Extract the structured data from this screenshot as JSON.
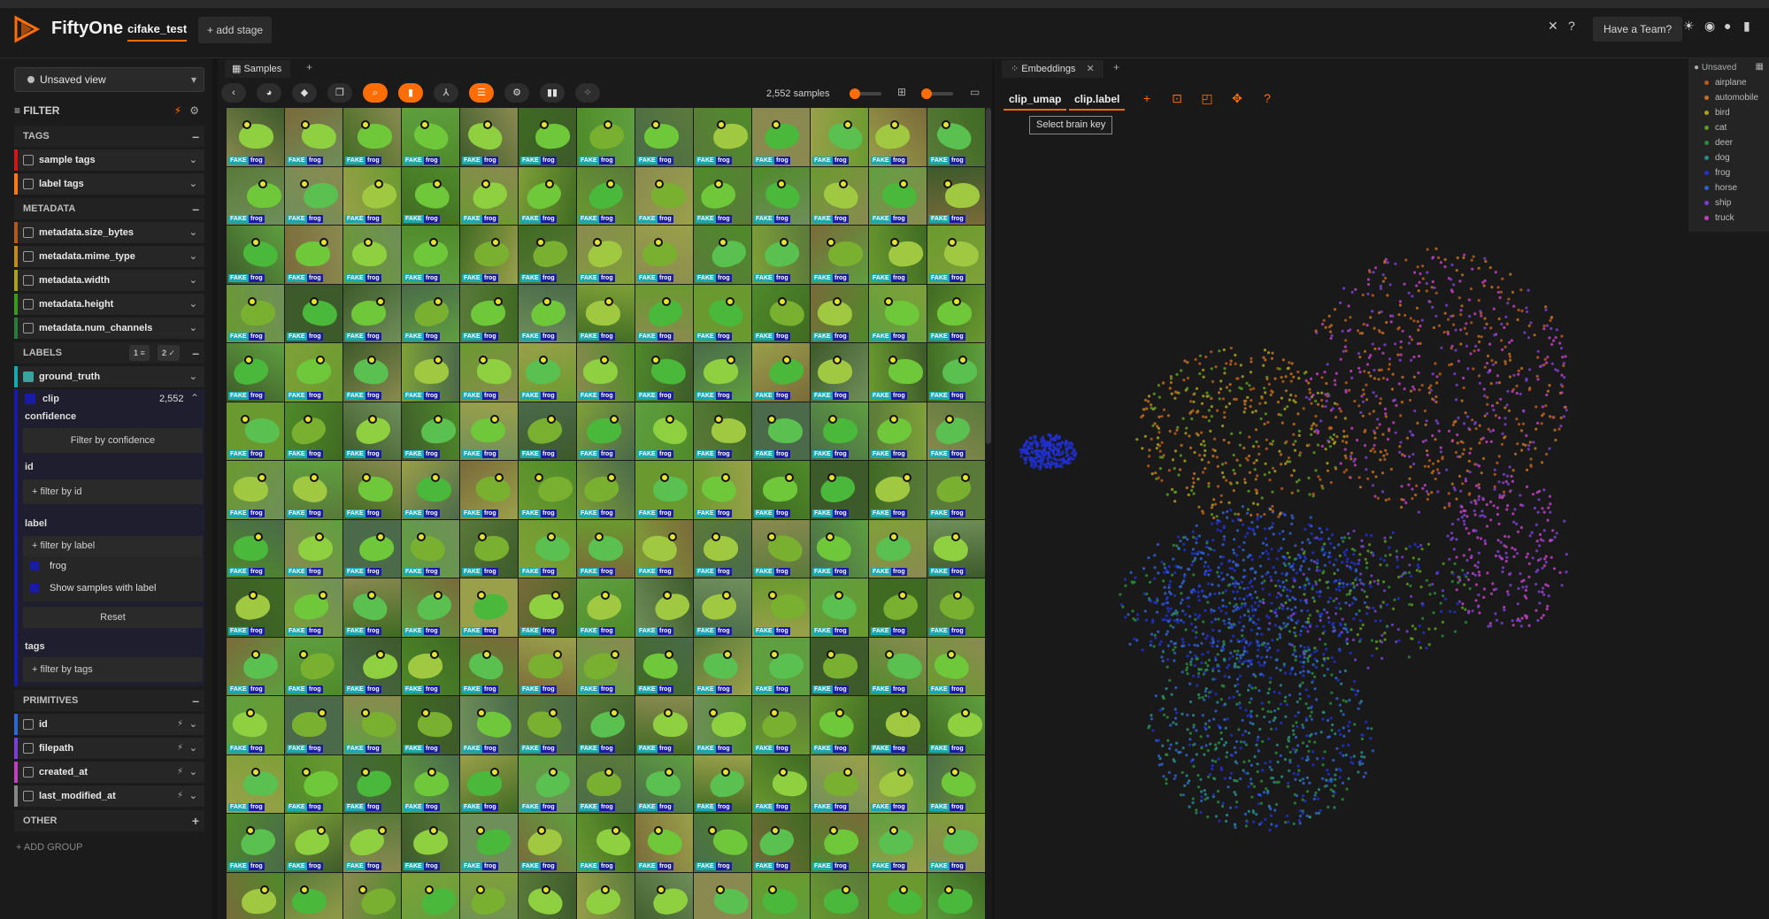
{
  "header": {
    "brand": "FiftyOne",
    "dataset": "cifake_test",
    "add_stage": "+ add stage",
    "team_button": "Have a Team?"
  },
  "sidebar": {
    "view_selector": "Unsaved view",
    "filter_label": "FILTER",
    "groups": {
      "tags": "TAGS",
      "metadata": "METADATA",
      "labels": "LABELS",
      "primitives": "PRIMITIVES",
      "other": "OTHER"
    },
    "tag_fields": [
      "sample tags",
      "label tags"
    ],
    "metadata_fields": [
      "metadata.size_bytes",
      "metadata.mime_type",
      "metadata.width",
      "metadata.height",
      "metadata.num_channels"
    ],
    "labels_counts": {
      "a": "1",
      "b": "2"
    },
    "ground_truth": "ground_truth",
    "clip": {
      "name": "clip",
      "count": "2,552",
      "confidence_label": "confidence",
      "confidence_button": "Filter by confidence",
      "id_label": "id",
      "id_placeholder": "+ filter by id",
      "label_label": "label",
      "label_placeholder": "+ filter by label",
      "label_value": "frog",
      "show_samples": "Show samples with label",
      "reset": "Reset",
      "tags_label": "tags",
      "tags_placeholder": "+ filter by tags"
    },
    "primitive_fields": [
      "id",
      "filepath",
      "created_at",
      "last_modified_at"
    ],
    "add_group": "+ ADD GROUP"
  },
  "samples": {
    "tab": "Samples",
    "count": "2,552 samples",
    "tag_fake": "FAKE",
    "tag_frog": "frog"
  },
  "embeddings": {
    "tab": "Embeddings",
    "brain_key": "clip_umap",
    "color_by": "clip.label",
    "tooltip": "Select brain key",
    "unsaved": "Unsaved",
    "legend": [
      {
        "label": "airplane",
        "color": "#b85a1a"
      },
      {
        "label": "automobile",
        "color": "#c07020"
      },
      {
        "label": "bird",
        "color": "#a8a020"
      },
      {
        "label": "cat",
        "color": "#5a9a20"
      },
      {
        "label": "deer",
        "color": "#2a8a3a"
      },
      {
        "label": "dog",
        "color": "#2a8a8a"
      },
      {
        "label": "frog",
        "color": "#2030d0"
      },
      {
        "label": "horse",
        "color": "#3060d0"
      },
      {
        "label": "ship",
        "color": "#7a40d0"
      },
      {
        "label": "truck",
        "color": "#c040c0"
      }
    ]
  }
}
